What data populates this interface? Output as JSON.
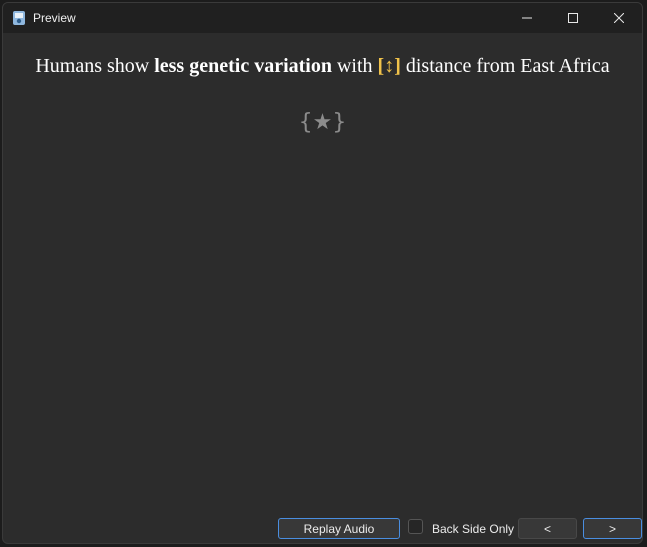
{
  "window": {
    "title": "Preview",
    "app_icon": "anki-icon",
    "controls": [
      "minimize-icon",
      "maximize-icon",
      "close-icon"
    ]
  },
  "card": {
    "text_before": "Humans show ",
    "text_bold": "less genetic variation",
    "text_middle": " with ",
    "arrow_glyph": "[↕]",
    "text_after": " distance from East Africa",
    "star_symbol": "{★}",
    "arrow_color": "#f0c24a"
  },
  "bottom_bar": {
    "replay_audio_label": "Replay Audio",
    "back_side_only_label": "Back Side Only",
    "back_side_only_checked": false,
    "prev_label": "<",
    "next_label": ">"
  }
}
